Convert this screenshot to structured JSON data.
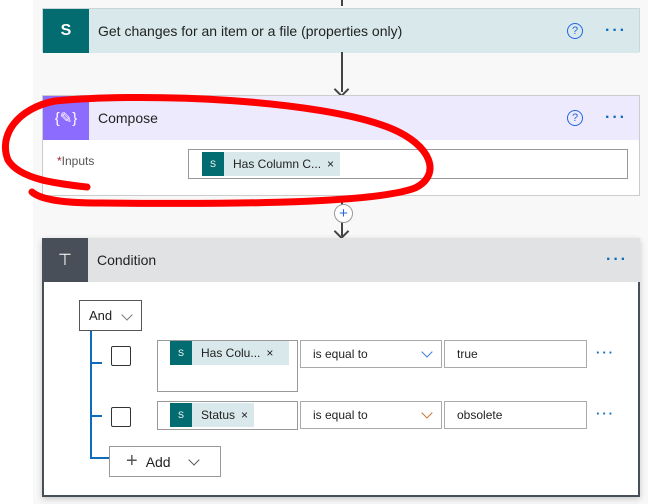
{
  "steps": [
    {
      "title": "Get changes for an item or a file (properties only)",
      "icon": "sharepoint-icon",
      "color": "#036c70",
      "header_bg": "#d9e8ea"
    },
    {
      "title": "Compose",
      "icon": "compose-braces-icon",
      "color": "#8c6cff",
      "header_bg": "#eeeafd",
      "inputs_required": "*",
      "inputs_label": "Inputs",
      "inputs_token": "Has Column C...",
      "token_close": "×"
    }
  ],
  "condition": {
    "title": "Condition",
    "icon": "condition-icon",
    "color": "#484f58",
    "header_bg": "#e1e2e4",
    "group_operator": "And",
    "rows": [
      {
        "left_token": "Has Colu...",
        "operator": "is equal to",
        "value": "true"
      },
      {
        "left_token": "Status",
        "operator": "is equal to",
        "value": "obsolete"
      }
    ],
    "add_label": "Add"
  },
  "common": {
    "help": "?",
    "more": "···",
    "close": "×",
    "plus": "+",
    "sp_letter": "S"
  },
  "annotation": {
    "color": "#ff0000"
  }
}
